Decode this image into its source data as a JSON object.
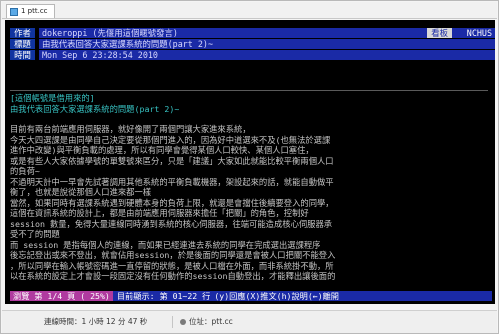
{
  "tab": {
    "label": "1 ptt.cc",
    "icon": "terminal-icon"
  },
  "header": {
    "author_label": "作者",
    "author_value": "dokeroppi (先偃用這個暱號發言)",
    "title_label": "標題",
    "title_value": "由我代表回答大家選課系統的問題(part 2)~",
    "time_label": "時間",
    "time_value": "Mon Sep  6 23:28:54 2010",
    "board_label": "看板",
    "board_value": "NCHUS"
  },
  "body": {
    "note_lines": [
      "[這個帳號是借用來的]",
      "由我代表回答大家選課系統的問題(part 2)~"
    ],
    "lines": [
      "目前有兩台前端應用伺服器，就好像開了兩個門讓大家進來系統，",
      "今天大四選課是由同學自己決定要從那個門進入的，因為好中道選來不及(也無法於選課",
      "進作中改變)與平衡負載的處理，所以有同學會覺得某個人口較快、某個人口塞住，",
      "或是有些人大家依據學號的單雙號來區分，只是「建議」大家如此就能比較平衡兩個人口",
      "的負荷~",
      "不過明天計中一早會先試著調用其他系統的平衡負載機器，架設起來的話，就能自動做平",
      "衡了，也就是說從那個人口進來都一樣",
      "當然，如果同時有選課系統遇到硬體本身的負荷上限，就還是會擋住後續要登入的同學，",
      "這個在資訊系統的設計上，都是由前端應用伺服器來擔任「把關」的角色，控制好",
      "session 數量，免得大量連線同時湧到系統的核心伺服器，往端可能造成核心伺服器承",
      "受不了的問題",
      "而 session 是指每個人的連線，而如果已經連進去系統的同學在完成選出選課程序",
      "後忘記登出或來不登出，就會佔用session，於是後面的同學還是會被人口把關不能登入",
      "，所以同學在輸入帳號密碼進一直停留的狀態，是被人口檔在外面，而非系統掛不動，所",
      "以在系統的設定上才會設一段固定沒有任何動作的session自動登出，才能釋出讓後面的"
    ]
  },
  "status_bar": {
    "position": "瀏覽 第 1/4 頁 ( 25%)",
    "line_range": "目前顯示: 第 01~22 行",
    "hint": "(y)回應(X)推文(h)說明(←)離開"
  },
  "bottom_bar": {
    "connection": "連線時間：1 小時 12 分 47 秒",
    "host_label": "位址：ptt.cc"
  },
  "colors": {
    "header_label_bg": "#1034a0",
    "header_value_bg": "#1a2aa6",
    "status_bg": "#1a2aa6",
    "status_pos_bg": "#b03a9f",
    "text": "#c4c4c4",
    "note_text": "#37c2c2"
  }
}
